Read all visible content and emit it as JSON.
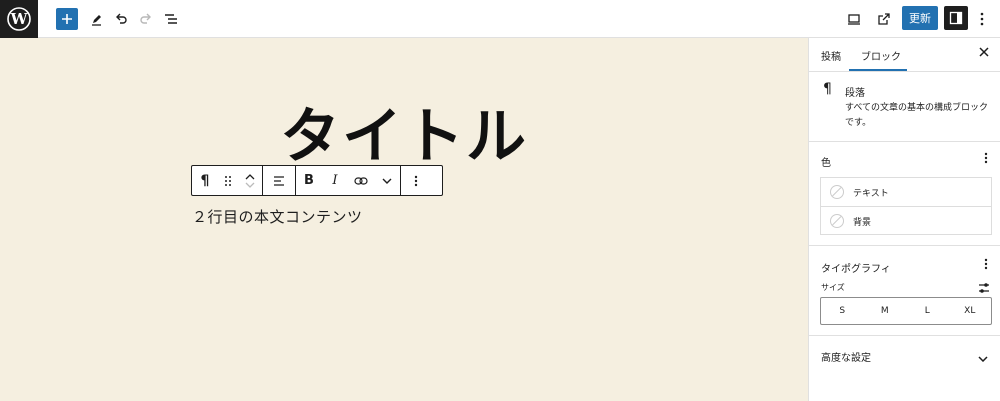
{
  "toolbar": {
    "update_label": "更新"
  },
  "editor": {
    "title": "タイトル",
    "paragraph": "２行目の本文コンテンツ"
  },
  "sidebar": {
    "tabs": [
      {
        "label": "投稿",
        "active": false
      },
      {
        "label": "ブロック",
        "active": true
      }
    ],
    "block": {
      "name": "段落",
      "description": "すべての文章の基本の構成ブロックです。"
    },
    "color_panel": {
      "title": "色",
      "items": [
        {
          "label": "テキスト"
        },
        {
          "label": "背景"
        }
      ]
    },
    "typography_panel": {
      "title": "タイポグラフィ",
      "size_label": "サイズ",
      "sizes": [
        "S",
        "M",
        "L",
        "XL"
      ]
    },
    "advanced_panel": {
      "title": "高度な設定"
    }
  },
  "colors": {
    "accent": "#2271b1",
    "canvas_bg": "#f5efe0",
    "dark": "#1e1e1e"
  },
  "icons": [
    "wordpress-logo-icon",
    "plus-icon",
    "pen-icon",
    "undo-icon",
    "redo-icon",
    "list-view-icon",
    "desktop-preview-icon",
    "external-link-icon",
    "sidebar-settings-icon",
    "kebab-icon",
    "pilcrow-icon",
    "drag-handle-icon",
    "move-up-icon",
    "move-down-icon",
    "align-icon",
    "bold-icon",
    "italic-icon",
    "link-icon",
    "chevron-down-icon",
    "close-icon",
    "sliders-icon"
  ]
}
